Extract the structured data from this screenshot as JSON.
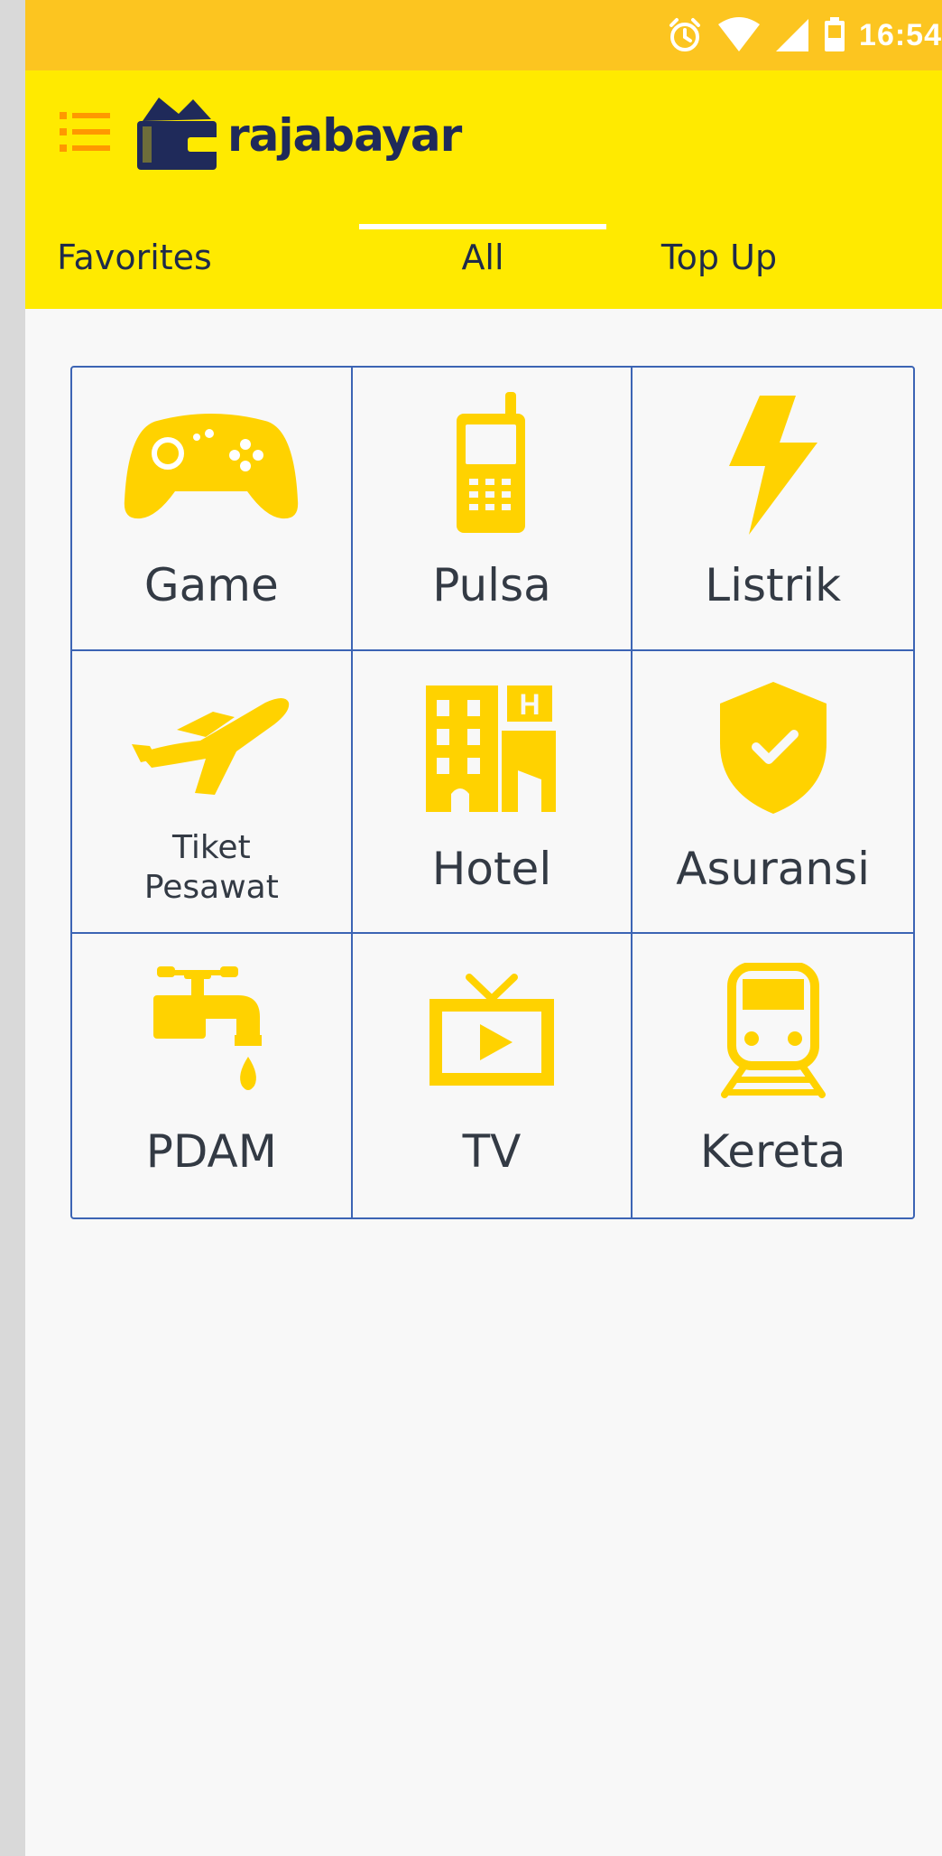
{
  "status_bar": {
    "time": "16:54",
    "icons": [
      "alarm-icon",
      "wifi-icon",
      "cell-signal-icon",
      "battery-icon"
    ],
    "color": "#fcc520"
  },
  "app_bar": {
    "color": "#ffea00",
    "logo_text": "rajabayar",
    "menu_icon": "menu-list-icon"
  },
  "tabs": [
    {
      "label": "Favorites",
      "selected": false
    },
    {
      "label": "All",
      "selected": true
    },
    {
      "label": "Top Up",
      "selected": false
    }
  ],
  "categories": [
    {
      "label": "Game",
      "icon": "gamepad-icon"
    },
    {
      "label": "Pulsa",
      "icon": "mobile-phone-icon"
    },
    {
      "label": "Listrik",
      "icon": "lightning-icon"
    },
    {
      "label": "Tiket Pesawat",
      "line1": "Tiket",
      "line2": "Pesawat",
      "icon": "airplane-icon"
    },
    {
      "label": "Hotel",
      "icon": "hotel-icon"
    },
    {
      "label": "Asuransi",
      "icon": "shield-check-icon"
    },
    {
      "label": "PDAM",
      "icon": "water-tap-icon"
    },
    {
      "label": "TV",
      "icon": "tv-icon"
    },
    {
      "label": "Kereta",
      "icon": "train-icon"
    }
  ],
  "colors": {
    "icon": "#ffd200",
    "grid_border": "#3c64b4",
    "logo": "#1f2a5a",
    "menu_icon": "#ff9800"
  }
}
